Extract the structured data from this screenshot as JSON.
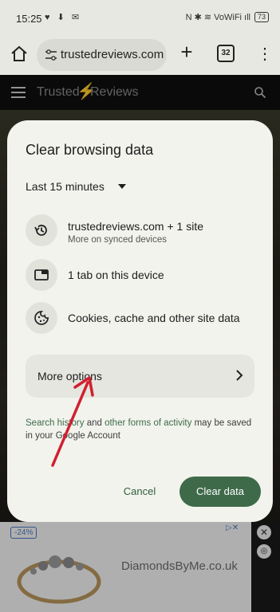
{
  "status_bar": {
    "time": "15:25",
    "left_icons": "♥ ⬇ ✉",
    "right_icons": "N ✱ ≋ VoWiFi ıll",
    "battery": "73"
  },
  "browser": {
    "url": "trustedreviews.com",
    "tab_count": "32"
  },
  "site": {
    "logo_left": "Trusted",
    "logo_right": "Reviews"
  },
  "dialog": {
    "title": "Clear browsing data",
    "time_range": "Last 15 minutes",
    "items": [
      {
        "title": "trustedreviews.com + 1 site",
        "subtitle": "More on synced devices",
        "icon": "history-icon"
      },
      {
        "title": "1 tab on this device",
        "icon": "tab-icon"
      },
      {
        "title": "Cookies, cache and other site data",
        "icon": "cookie-icon"
      }
    ],
    "more_options": "More options",
    "note_link": "Search history",
    "note_mid": " and ",
    "note_link2": "other forms of activity",
    "note_tail": " may be saved in your Google Account",
    "cancel": "Cancel",
    "clear": "Clear data"
  },
  "ad": {
    "discount": "-24%",
    "brand": "DiamondsByMe.co.uk"
  },
  "colors": {
    "accent": "#3f6a4a",
    "dialog_bg": "#f2f3ed",
    "arrow": "#d1202f"
  }
}
